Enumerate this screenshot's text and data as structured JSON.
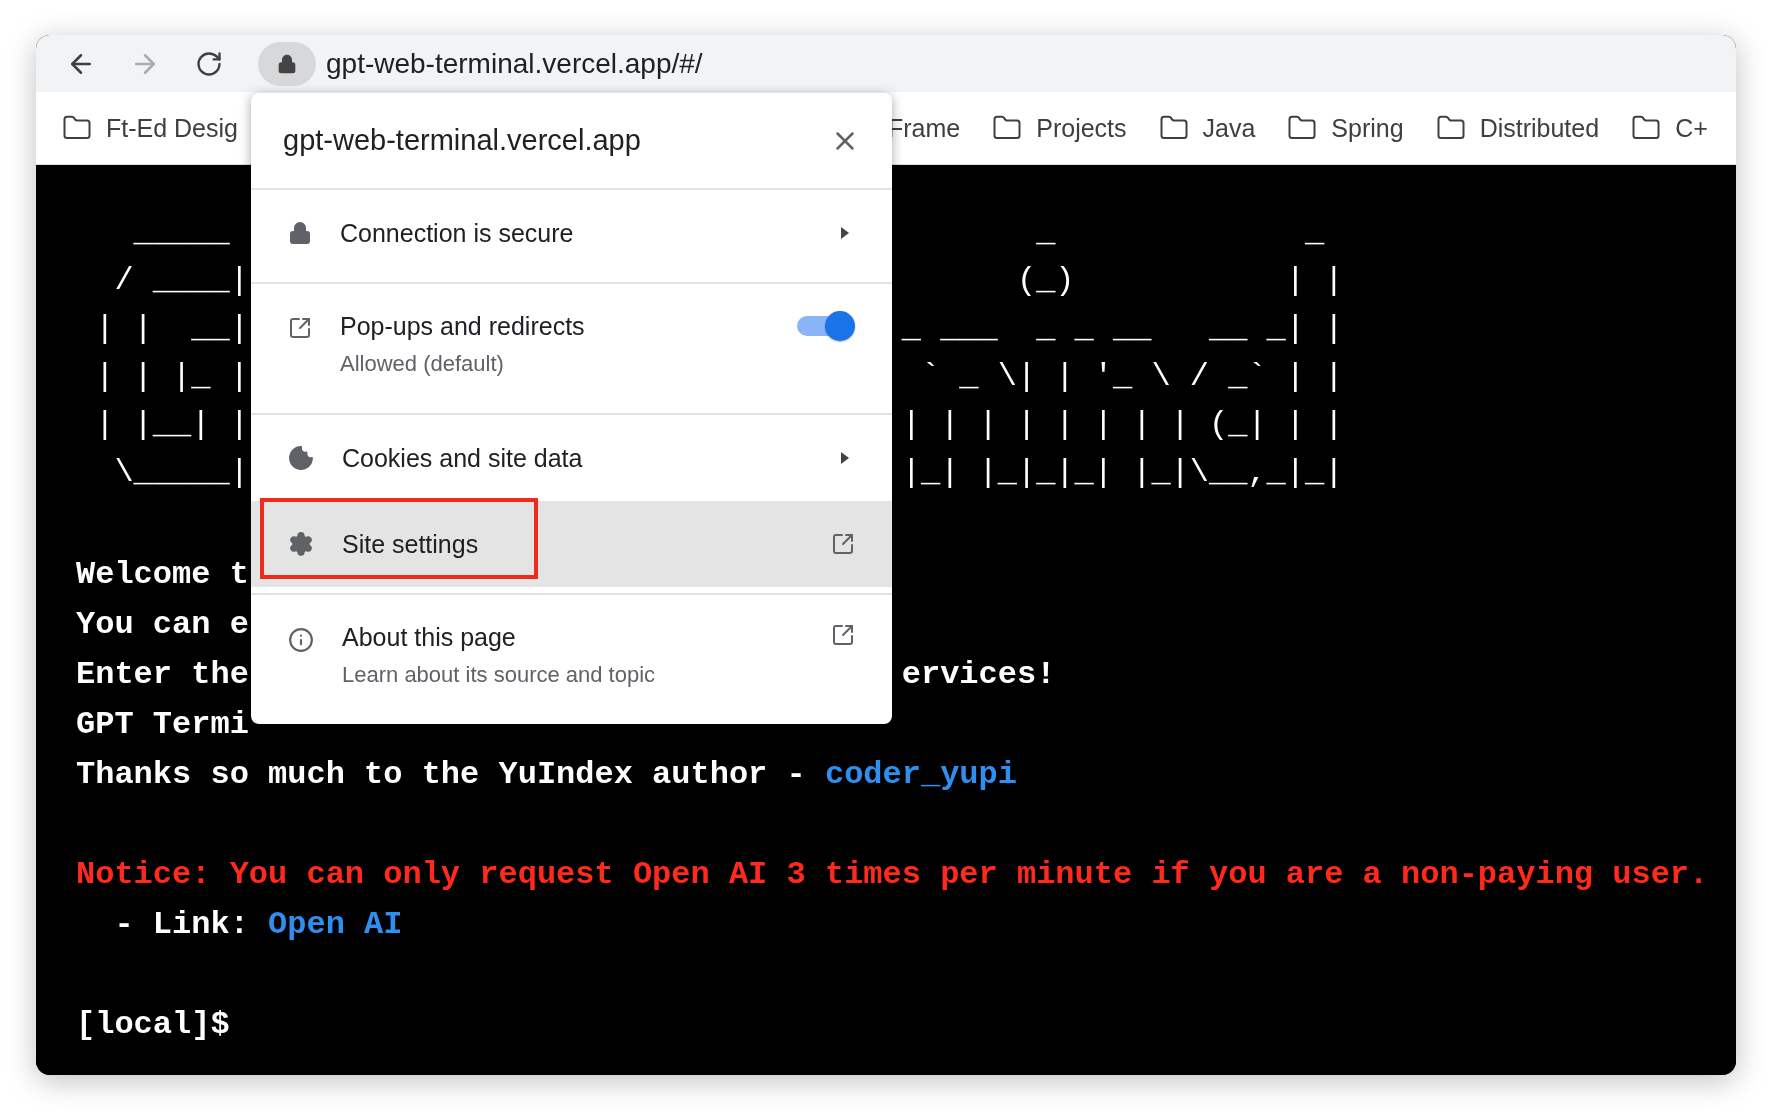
{
  "toolbar": {
    "nav": [
      {
        "kind": "back",
        "disabled": false
      },
      {
        "kind": "forward",
        "disabled": true
      },
      {
        "kind": "reload",
        "disabled": false
      }
    ],
    "url": "gpt-web-terminal.vercel.app/#/"
  },
  "bookmarks": {
    "left": [
      "Ft-Ed Desig"
    ],
    "frame_label": "Frame",
    "right": [
      "Projects",
      "Java",
      "Spring",
      "Distributed",
      "C+"
    ]
  },
  "popup": {
    "title": "gpt-web-terminal.vercel.app",
    "sections": [
      [
        {
          "kind": "submenu",
          "label": "Connection is secure",
          "selected": false,
          "annotated": false
        }
      ],
      [
        {
          "kind": "toggle",
          "label": "Pop-ups and redirects",
          "sublabel": "Allowed (default)",
          "on": true,
          "selected": false,
          "annotated": false
        }
      ],
      [
        {
          "kind": "submenu",
          "label": "Cookies and site data",
          "selected": false,
          "annotated": false
        },
        {
          "kind": "external",
          "label": "Site settings",
          "selected": true,
          "annotated": true
        }
      ],
      [
        {
          "kind": "external",
          "label": "About this page",
          "sublabel": "Learn about its source and topic",
          "selected": false,
          "annotated": false
        }
      ]
    ]
  },
  "terminal": {
    "ascii_art": [
      {
        "left": "   _____",
        "right": "       _             _"
      },
      {
        "left": "  / ____|",
        "right": "      (_)           | |"
      },
      {
        "left": " | |  __|",
        "right": "_ ___  _ _ __   __ _| |"
      },
      {
        "left": " | | |_ |",
        "right": " ` _ \\| | '_ \\ / _` | |"
      },
      {
        "left": " | |__| |",
        "right": "| | | | | | | | (_| | |"
      },
      {
        "left": "  \\_____|",
        "right": "|_| |_|_|_| |_|\\__,_|_|"
      }
    ],
    "blocks": [
      [
        {
          "segments": [
            {
              "kind": "plain",
              "text": "Welcome t"
            }
          ]
        },
        {
          "segments": [
            {
              "kind": "plain",
              "text": "You can e"
            }
          ]
        },
        {
          "segments": [
            {
              "kind": "plain",
              "text": "Enter the"
            }
          ],
          "right": "ervices!"
        },
        {
          "segments": [
            {
              "kind": "plain",
              "text": "GPT Termi"
            }
          ]
        },
        {
          "segments": [
            {
              "kind": "plain",
              "text": "Thanks so much to the YuIndex author - "
            },
            {
              "kind": "link",
              "text": "coder_yupi"
            }
          ]
        }
      ],
      [
        {
          "segments": [
            {
              "kind": "notice",
              "text": "Notice: You can only request Open AI 3 times per minute if you are a non-paying user."
            }
          ]
        },
        {
          "segments": [
            {
              "kind": "plain",
              "text": "  - Link: "
            },
            {
              "kind": "link",
              "text": "Open AI"
            }
          ]
        }
      ],
      [
        {
          "segments": [
            {
              "kind": "plain",
              "text": "[local]$"
            }
          ]
        }
      ]
    ]
  }
}
